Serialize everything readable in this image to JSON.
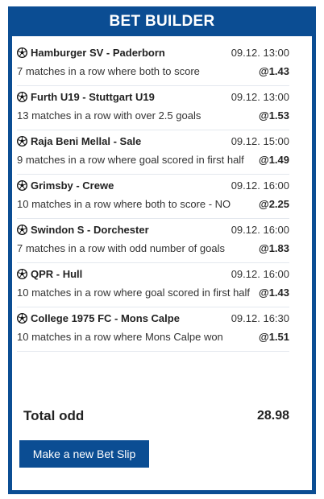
{
  "header": {
    "title": "BET BUILDER"
  },
  "bets": [
    {
      "match": "Hamburger SV - Paderborn",
      "time": "09.12. 13:00",
      "desc": "7 matches in a row where both to score",
      "odd": "@1.43"
    },
    {
      "match": "Furth U19 - Stuttgart U19",
      "time": "09.12. 13:00",
      "desc": "13 matches in a row with over 2.5 goals",
      "odd": "@1.53"
    },
    {
      "match": "Raja Beni Mellal - Sale",
      "time": "09.12. 15:00",
      "desc": "9 matches in a row where goal scored in first half",
      "odd": "@1.49"
    },
    {
      "match": "Grimsby - Crewe",
      "time": "09.12. 16:00",
      "desc": "10 matches in a row where both to score - NO",
      "odd": "@2.25"
    },
    {
      "match": "Swindon S - Dorchester",
      "time": "09.12. 16:00",
      "desc": "7 matches in a row with odd number of goals",
      "odd": "@1.83"
    },
    {
      "match": "QPR - Hull",
      "time": "09.12. 16:00",
      "desc": "10 matches in a row where goal scored in first half",
      "odd": "@1.43"
    },
    {
      "match": "College 1975 FC - Mons Calpe",
      "time": "09.12. 16:30",
      "desc": "10 matches in a row where Mons Calpe won",
      "odd": "@1.51"
    }
  ],
  "total": {
    "label": "Total odd",
    "value": "28.98"
  },
  "actions": {
    "new_slip_label": "Make a new Bet Slip"
  },
  "icons": {
    "match": "soccer-ball-icon"
  },
  "colors": {
    "brand": "#0b4d93"
  }
}
